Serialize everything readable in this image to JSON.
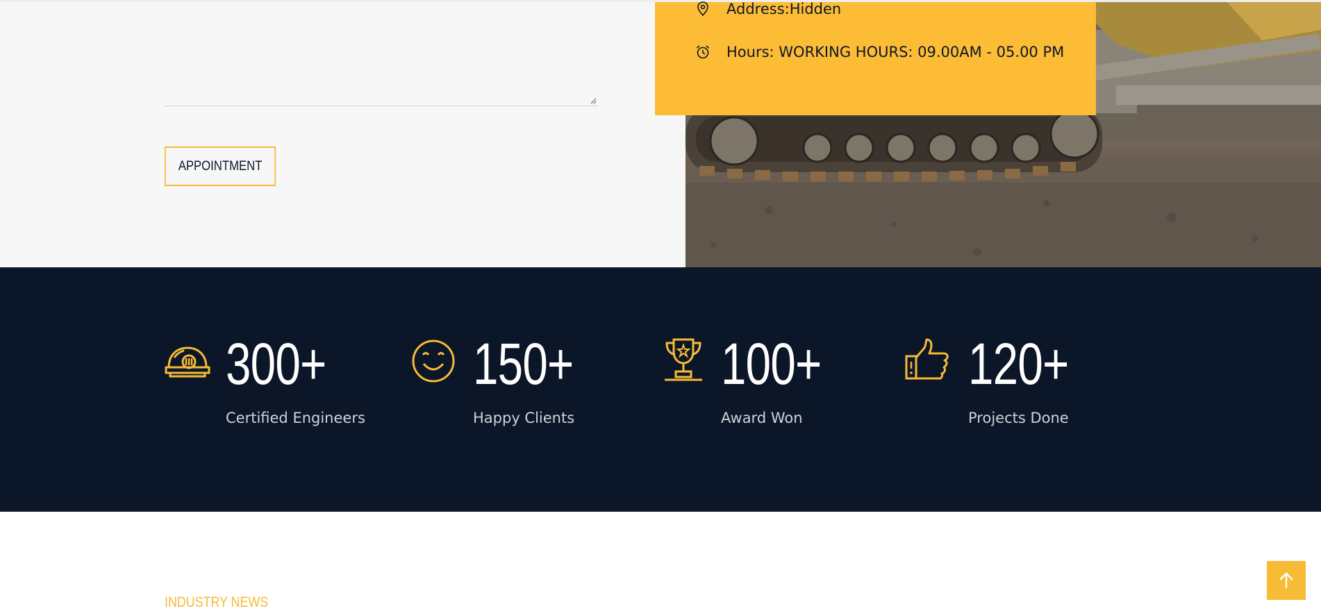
{
  "form": {
    "appointment_button": "APPOINTMENT"
  },
  "contact": {
    "address": "Address:Hidden",
    "hours": "Hours: WORKING HOURS: 09.00AM - 05.00 PM",
    "address_icon": "map-pin-icon",
    "hours_icon": "alarm-clock-icon"
  },
  "stats": [
    {
      "icon": "hardhat-icon",
      "value": "300+",
      "label": "Certified Engineers"
    },
    {
      "icon": "smiley-icon",
      "value": "150+",
      "label": "Happy Clients"
    },
    {
      "icon": "trophy-icon",
      "value": "100+",
      "label": "Award Won"
    },
    {
      "icon": "thumbs-up-icon",
      "value": "120+",
      "label": "Projects Done"
    }
  ],
  "news": {
    "section_label": "INDUSTRY NEWS"
  },
  "scroll_top": {
    "icon": "arrow-up-icon"
  },
  "colors": {
    "accent": "#f7bb36",
    "contact_box": "#fdbc36",
    "stats_bg": "#0b1628",
    "panel_bg": "#f7f7f7"
  }
}
